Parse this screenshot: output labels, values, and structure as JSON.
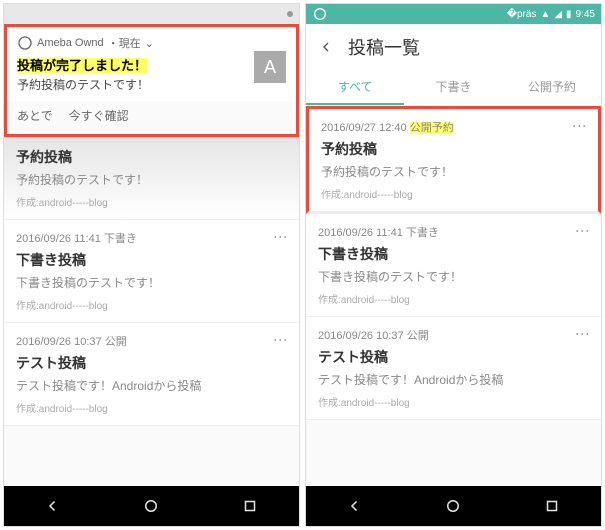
{
  "left": {
    "statusbar": {
      "time": ""
    },
    "notification": {
      "app": "Ameba Ownd",
      "when": "・現在",
      "chevron": "⌄",
      "title": "投稿が完了しました！",
      "body": "予約投稿のテストです！",
      "thumb_letter": "A",
      "action_later": "あとで",
      "action_now": "今すぐ確認"
    },
    "posts": [
      {
        "date": "",
        "status": "",
        "title": "予約投稿",
        "body": "予約投稿のテストです！",
        "author": "作成:android-----blog"
      },
      {
        "date": "2016/09/26 11:41",
        "status": "下書き",
        "title": "下書き投稿",
        "body": "下書き投稿のテストです！",
        "author": "作成:android-----blog"
      },
      {
        "date": "2016/09/26 10:37",
        "status": "公開",
        "title": "テスト投稿",
        "body": "テスト投稿です！Androidから投稿",
        "author": "作成:android-----blog"
      }
    ]
  },
  "right": {
    "statusbar": {
      "time": "9:45"
    },
    "header": {
      "title": "投稿一覧"
    },
    "tabs": {
      "all": "すべて",
      "draft": "下書き",
      "scheduled": "公開予約"
    },
    "posts": [
      {
        "date": "2016/09/27 12:40",
        "status": "公開予約",
        "title": "予約投稿",
        "body": "予約投稿のテストです！",
        "author": "作成:android-----blog",
        "highlight": true
      },
      {
        "date": "2016/09/26 11:41",
        "status": "下書き",
        "title": "下書き投稿",
        "body": "下書き投稿のテストです！",
        "author": "作成:android-----blog"
      },
      {
        "date": "2016/09/26 10:37",
        "status": "公開",
        "title": "テスト投稿",
        "body": "テスト投稿です！Androidから投稿",
        "author": "作成:android-----blog"
      }
    ]
  }
}
